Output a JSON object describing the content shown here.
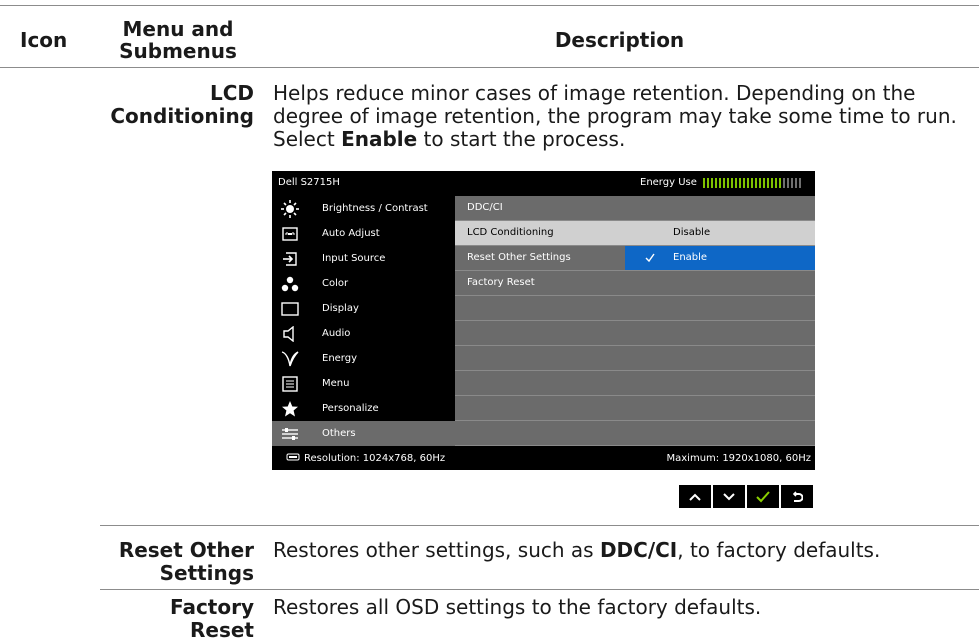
{
  "header": {
    "col_icon": "Icon",
    "col_menu": "Menu and Submenus",
    "col_desc": "Description"
  },
  "rows": [
    {
      "label": "LCD Conditioning",
      "desc_parts": [
        "Helps reduce minor cases of image retention. Depending on the degree of image retention, the program may take some time to run. Select ",
        "Enable",
        " to start the process."
      ]
    },
    {
      "label": "Reset Other Settings",
      "desc_parts": [
        "Restores other settings, such as ",
        "DDC/CI",
        ", to factory defaults."
      ]
    },
    {
      "label": "Factory Reset",
      "desc_parts": [
        "Restores all OSD settings to the factory defaults."
      ]
    }
  ],
  "osd": {
    "model": "Dell S2715H",
    "energy_label": "Energy Use",
    "energy_level": 0.8,
    "menu": [
      {
        "label": "Brightness / Contrast",
        "icon": "brightness-icon"
      },
      {
        "label": "Auto Adjust",
        "icon": "auto-adjust-icon"
      },
      {
        "label": "Input Source",
        "icon": "input-source-icon"
      },
      {
        "label": "Color",
        "icon": "color-icon"
      },
      {
        "label": "Display",
        "icon": "display-icon"
      },
      {
        "label": "Audio",
        "icon": "audio-icon"
      },
      {
        "label": "Energy",
        "icon": "energy-icon"
      },
      {
        "label": "Menu",
        "icon": "menu-icon"
      },
      {
        "label": "Personalize",
        "icon": "star-icon"
      },
      {
        "label": "Others",
        "icon": "others-icon"
      }
    ],
    "submenu": [
      {
        "label": "DDC/CI",
        "value": ""
      },
      {
        "label": "LCD Conditioning",
        "value": "Disable"
      },
      {
        "label": "Reset Other Settings",
        "value": "Enable"
      },
      {
        "label": "Factory Reset",
        "value": ""
      }
    ],
    "resolution": "Resolution: 1024x768, 60Hz",
    "maximum": "Maximum: 1920x1080, 60Hz"
  },
  "nav_buttons": [
    "up-icon",
    "down-icon",
    "check-icon",
    "back-icon"
  ]
}
